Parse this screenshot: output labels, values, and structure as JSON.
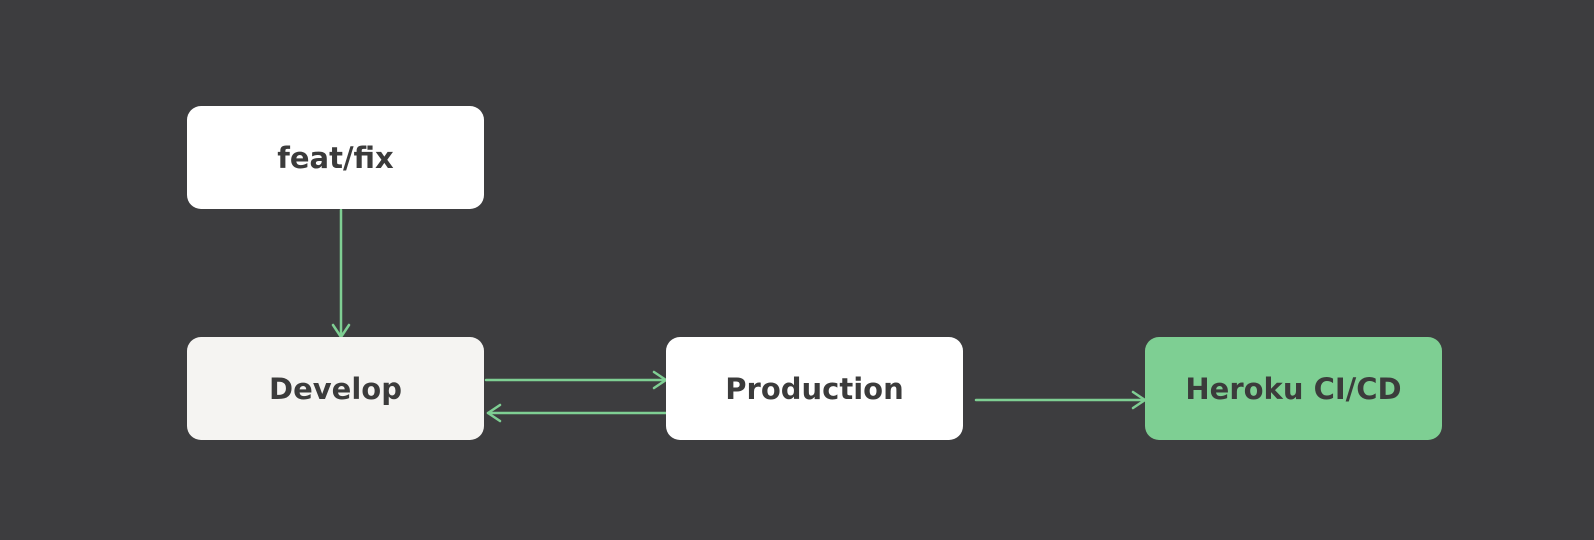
{
  "diagram": {
    "background": "#3d3d3f",
    "edge_color": "#7fcf93",
    "nodes": {
      "feat": {
        "label": "feat/fix",
        "fill": "#ffffff"
      },
      "develop": {
        "label": "Develop",
        "fill": "#f5f4f2"
      },
      "production": {
        "label": "Production",
        "fill": "#ffffff"
      },
      "heroku": {
        "label": "Heroku CI/CD",
        "fill": "#7ecf93"
      }
    },
    "edges": [
      {
        "from": "feat",
        "to": "develop"
      },
      {
        "from": "develop",
        "to": "production"
      },
      {
        "from": "production",
        "to": "develop"
      },
      {
        "from": "production",
        "to": "heroku"
      }
    ]
  }
}
